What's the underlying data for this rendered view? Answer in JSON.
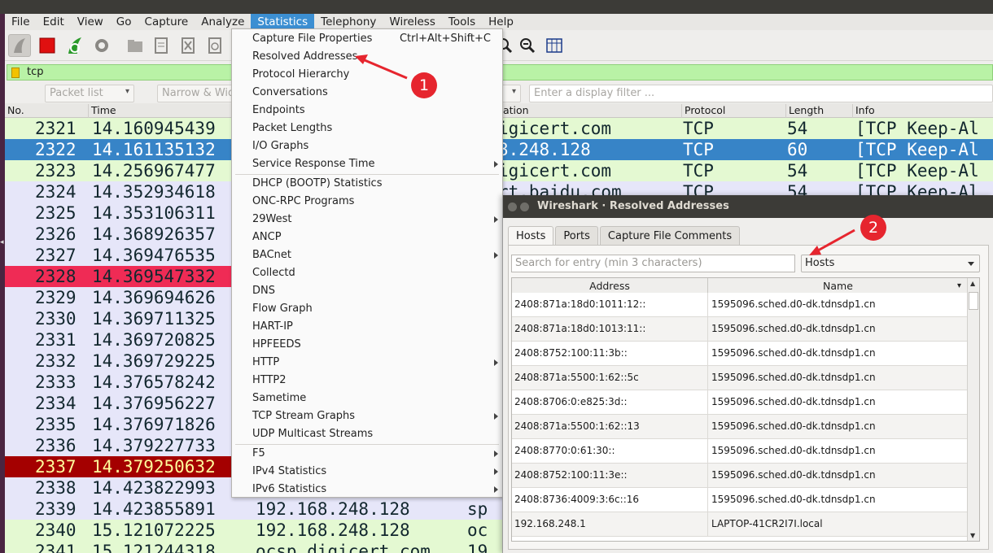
{
  "menubar": [
    "File",
    "Edit",
    "View",
    "Go",
    "Capture",
    "Analyze",
    "Statistics",
    "Telephony",
    "Wireless",
    "Tools",
    "Help"
  ],
  "active_menu": "Statistics",
  "filter": {
    "value": "tcp"
  },
  "find": {
    "packet_list": "Packet list",
    "narrow_wide": "Narrow & Wide",
    "display_filter_placeholder": "Enter a display filter ..."
  },
  "columns": {
    "no": "No.",
    "time": "Time",
    "destination": "ation",
    "protocol": "Protocol",
    "length": "Length",
    "info": "Info"
  },
  "packets": [
    {
      "no": "2321",
      "time": "14.160945439",
      "mid": "",
      "dst": "p.digicert.com",
      "proto": "TCP",
      "len": "54",
      "info": "[TCP Keep-Al",
      "bg": "#e4f9d2",
      "fg": "#12272e"
    },
    {
      "no": "2322",
      "time": "14.161135132",
      "mid": "",
      "dst": ".168.248.128",
      "proto": "TCP",
      "len": "60",
      "info": "[TCP Keep-Al",
      "bg": "#3784c7",
      "fg": "#ffffff"
    },
    {
      "no": "2323",
      "time": "14.256967477",
      "mid": "",
      "dst": "p.digicert.com",
      "proto": "TCP",
      "len": "54",
      "info": "[TCP Keep-Al",
      "bg": "#e4f9d2",
      "fg": "#12272e"
    },
    {
      "no": "2324",
      "time": "14.352934618",
      "mid": "",
      "dst": "sport.baidu.com",
      "proto": "TCP",
      "len": "54",
      "info": "[TCP Keep-Al",
      "bg": "#e6e6f9",
      "fg": "#12272e"
    },
    {
      "no": "2325",
      "time": "14.353106311",
      "mid": "",
      "dst": "",
      "proto": "",
      "len": "",
      "info": "",
      "bg": "#e6e6f9",
      "fg": "#12272e"
    },
    {
      "no": "2326",
      "time": "14.368926357",
      "mid": "",
      "dst": "",
      "proto": "",
      "len": "",
      "info": "",
      "bg": "#e6e6f9",
      "fg": "#12272e"
    },
    {
      "no": "2327",
      "time": "14.369476535",
      "mid": "",
      "dst": "",
      "proto": "",
      "len": "",
      "info": "",
      "bg": "#e6e6f9",
      "fg": "#12272e"
    },
    {
      "no": "2328",
      "time": "14.369547332",
      "mid": "",
      "dst": "",
      "proto": "",
      "len": "",
      "info": "",
      "bg": "#ef2b55",
      "fg": "#12272e"
    },
    {
      "no": "2329",
      "time": "14.369694626",
      "mid": "",
      "dst": "",
      "proto": "",
      "len": "",
      "info": "",
      "bg": "#e6e6f9",
      "fg": "#12272e"
    },
    {
      "no": "2330",
      "time": "14.369711325",
      "mid": "",
      "dst": "",
      "proto": "",
      "len": "",
      "info": "",
      "bg": "#e6e6f9",
      "fg": "#12272e"
    },
    {
      "no": "2331",
      "time": "14.369720825",
      "mid": "",
      "dst": "",
      "proto": "",
      "len": "",
      "info": "",
      "bg": "#e6e6f9",
      "fg": "#12272e"
    },
    {
      "no": "2332",
      "time": "14.369729225",
      "mid": "",
      "dst": "",
      "proto": "",
      "len": "",
      "info": "",
      "bg": "#e6e6f9",
      "fg": "#12272e"
    },
    {
      "no": "2333",
      "time": "14.376578242",
      "mid": "",
      "dst": "",
      "proto": "",
      "len": "",
      "info": "",
      "bg": "#e6e6f9",
      "fg": "#12272e"
    },
    {
      "no": "2334",
      "time": "14.376956227",
      "mid": "",
      "dst": "",
      "proto": "",
      "len": "",
      "info": "",
      "bg": "#e6e6f9",
      "fg": "#12272e"
    },
    {
      "no": "2335",
      "time": "14.376971826",
      "mid": "",
      "dst": "",
      "proto": "",
      "len": "",
      "info": "",
      "bg": "#e6e6f9",
      "fg": "#12272e"
    },
    {
      "no": "2336",
      "time": "14.379227733",
      "mid": "",
      "dst": "",
      "proto": "",
      "len": "",
      "info": "",
      "bg": "#e6e6f9",
      "fg": "#12272e"
    },
    {
      "no": "2337",
      "time": "14.379250632",
      "mid": "",
      "dst": "",
      "proto": "",
      "len": "",
      "info": "",
      "bg": "#a40000",
      "fg": "#fffc9c"
    },
    {
      "no": "2338",
      "time": "14.423822993",
      "mid": "",
      "dst": "",
      "proto": "",
      "len": "",
      "info": "",
      "bg": "#e6e6f9",
      "fg": "#12272e"
    },
    {
      "no": "2339",
      "time": "14.423855891",
      "mid": "192.168.248.128",
      "dst": "sp",
      "proto": "",
      "len": "",
      "info": "",
      "bg": "#e6e6f9",
      "fg": "#12272e"
    },
    {
      "no": "2340",
      "time": "15.121072225",
      "mid": "192.168.248.128",
      "dst": "oc",
      "proto": "",
      "len": "",
      "info": "",
      "bg": "#e4f9d2",
      "fg": "#12272e"
    },
    {
      "no": "2341",
      "time": "15.121244318",
      "mid": "ocsp.digicert.com",
      "dst": "19",
      "proto": "",
      "len": "",
      "info": "",
      "bg": "#e4f9d2",
      "fg": "#12272e"
    }
  ],
  "stats_menu": {
    "items": [
      {
        "label": "Capture File Properties",
        "shortcut": "Ctrl+Alt+Shift+C",
        "sub": false
      },
      {
        "label": "Resolved Addresses",
        "shortcut": "",
        "sub": false
      },
      {
        "label": "Protocol Hierarchy",
        "shortcut": "",
        "sub": false
      },
      {
        "label": "Conversations",
        "shortcut": "",
        "sub": false
      },
      {
        "label": "Endpoints",
        "shortcut": "",
        "sub": false
      },
      {
        "label": "Packet Lengths",
        "shortcut": "",
        "sub": false
      },
      {
        "label": "I/O Graphs",
        "shortcut": "",
        "sub": false
      },
      {
        "label": "Service Response Time",
        "shortcut": "",
        "sub": true
      },
      {
        "sep": true
      },
      {
        "label": "DHCP (BOOTP) Statistics",
        "shortcut": "",
        "sub": false
      },
      {
        "label": "ONC-RPC Programs",
        "shortcut": "",
        "sub": false
      },
      {
        "label": "29West",
        "shortcut": "",
        "sub": true
      },
      {
        "label": "ANCP",
        "shortcut": "",
        "sub": false
      },
      {
        "label": "BACnet",
        "shortcut": "",
        "sub": true
      },
      {
        "label": "Collectd",
        "shortcut": "",
        "sub": false
      },
      {
        "label": "DNS",
        "shortcut": "",
        "sub": false
      },
      {
        "label": "Flow Graph",
        "shortcut": "",
        "sub": false
      },
      {
        "label": "HART-IP",
        "shortcut": "",
        "sub": false
      },
      {
        "label": "HPFEEDS",
        "shortcut": "",
        "sub": false
      },
      {
        "label": "HTTP",
        "shortcut": "",
        "sub": true
      },
      {
        "label": "HTTP2",
        "shortcut": "",
        "sub": false
      },
      {
        "label": "Sametime",
        "shortcut": "",
        "sub": false
      },
      {
        "label": "TCP Stream Graphs",
        "shortcut": "",
        "sub": true
      },
      {
        "label": "UDP Multicast Streams",
        "shortcut": "",
        "sub": false
      },
      {
        "sep": true
      },
      {
        "label": "F5",
        "shortcut": "",
        "sub": true
      },
      {
        "label": "IPv4 Statistics",
        "shortcut": "",
        "sub": true
      },
      {
        "label": "IPv6 Statistics",
        "shortcut": "",
        "sub": true
      }
    ]
  },
  "dialog": {
    "title": "Wireshark · Resolved Addresses",
    "tabs": [
      "Hosts",
      "Ports",
      "Capture File Comments"
    ],
    "search_placeholder": "Search for entry (min 3 characters)",
    "type_value": "Hosts",
    "col_address": "Address",
    "col_name": "Name",
    "rows": [
      {
        "address": "2408:871a:18d0:1011:12::",
        "name": "1595096.sched.d0-dk.tdnsdp1.cn"
      },
      {
        "address": "2408:871a:18d0:1013:11::",
        "name": "1595096.sched.d0-dk.tdnsdp1.cn"
      },
      {
        "address": "2408:8752:100:11:3b::",
        "name": "1595096.sched.d0-dk.tdnsdp1.cn"
      },
      {
        "address": "2408:871a:5500:1:62::5c",
        "name": "1595096.sched.d0-dk.tdnsdp1.cn"
      },
      {
        "address": "2408:8706:0:e825:3d::",
        "name": "1595096.sched.d0-dk.tdnsdp1.cn"
      },
      {
        "address": "2408:871a:5500:1:62::13",
        "name": "1595096.sched.d0-dk.tdnsdp1.cn"
      },
      {
        "address": "2408:8770:0:61:30::",
        "name": "1595096.sched.d0-dk.tdnsdp1.cn"
      },
      {
        "address": "2408:8752:100:11:3e::",
        "name": "1595096.sched.d0-dk.tdnsdp1.cn"
      },
      {
        "address": "2408:8736:4009:3:6c::16",
        "name": "1595096.sched.d0-dk.tdnsdp1.cn"
      },
      {
        "address": "192.168.248.1",
        "name": "LAPTOP-41CR2I7I.local"
      }
    ]
  },
  "annotations": [
    "1",
    "2"
  ]
}
